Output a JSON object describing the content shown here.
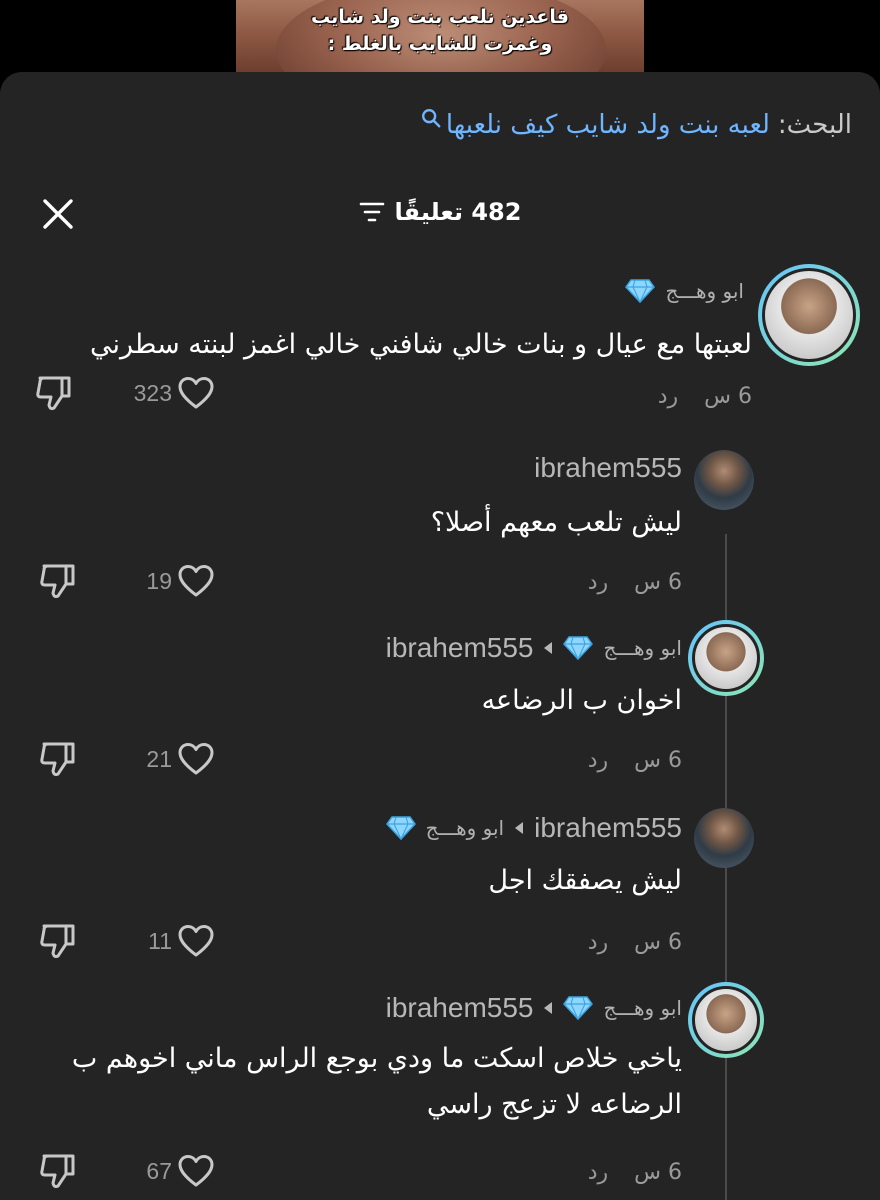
{
  "video": {
    "caption_line1": "قاعدين نلعب بنت ولد شايب",
    "caption_line2": "وغمزت للشايب بالغلط :"
  },
  "search": {
    "prefix": "البحث:",
    "query": "لعبه بنت ولد شايب كيف نلعبها",
    "icon": "search-icon"
  },
  "header": {
    "comment_count": "482 تعليقًا"
  },
  "comments": [
    {
      "author": "ابو وهـــج",
      "text": "لعبتها مع عيال و بنات خالي شافني خالي اغمز لبنته سطرني",
      "time": "6 س",
      "reply_label": "رد",
      "likes": "323"
    },
    {
      "author": "ibrahem555",
      "text": "ليش تلعب معهم أصلا؟",
      "time": "6 س",
      "reply_label": "رد",
      "likes": "19"
    },
    {
      "author": "ابو وهـــج",
      "reply_to": "ibrahem555",
      "text": "اخوان ب الرضاعه",
      "time": "6 س",
      "reply_label": "رد",
      "likes": "21"
    },
    {
      "author": "ibrahem555",
      "reply_to": "ابو وهـــج",
      "text": "ليش يصفقك اجل",
      "time": "6 س",
      "reply_label": "رد",
      "likes": "11"
    },
    {
      "author": "ابو وهـــج",
      "reply_to": "ibrahem555",
      "text_line1": "ياخي خلاص اسكت ما ودي بوجع الراس ماني اخوهم ب",
      "text_line2": "الرضاعه لا تزعج راسي",
      "time": "6 س",
      "reply_label": "رد",
      "likes": "67"
    }
  ],
  "colors": {
    "sheet_bg": "#242424",
    "link_blue": "#6fb5ff",
    "muted": "#9a9a9a",
    "avatar_ring_start": "#63c4ff",
    "avatar_ring_end": "#8fe6b0"
  }
}
